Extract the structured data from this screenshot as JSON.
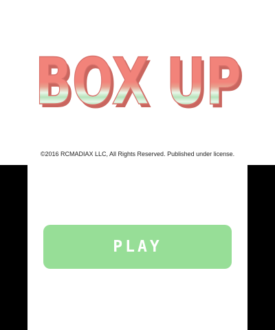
{
  "logo": {
    "text": "BOX UP",
    "colors": {
      "main": "#f2837a",
      "shadow": "#c9665f",
      "stripe_light": "#e8f6e8",
      "stripe_green": "#9bd9a6"
    }
  },
  "copyright": {
    "text": "©2016 RCMADIAX LLC, All Rights Reserved. Published under license."
  },
  "play_button": {
    "label": "PLAY",
    "color": "#97de97"
  },
  "colors": {
    "screen_background": "#ffffff",
    "border": "#000000"
  }
}
